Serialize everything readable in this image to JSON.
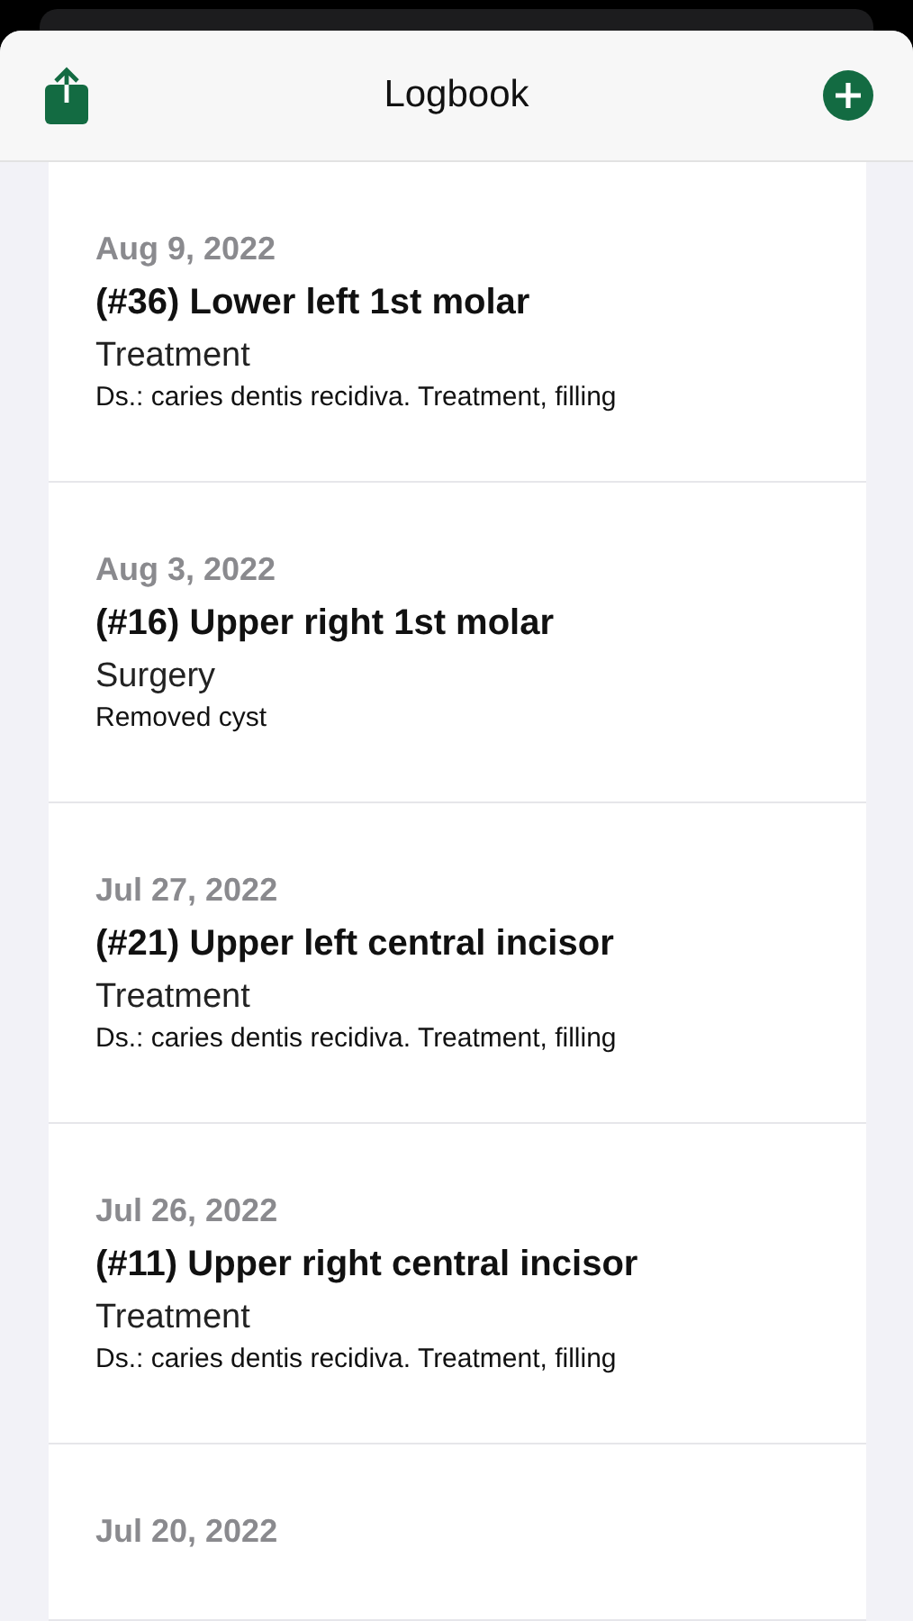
{
  "header": {
    "title": "Logbook"
  },
  "entries": [
    {
      "date": "Aug 9, 2022",
      "title": "(#36) Lower left 1st molar",
      "category": "Treatment",
      "note": "Ds.: caries dentis recidiva. Treatment, filling"
    },
    {
      "date": "Aug 3, 2022",
      "title": "(#16) Upper right 1st molar",
      "category": "Surgery",
      "note": "Removed cyst"
    },
    {
      "date": "Jul 27, 2022",
      "title": "(#21) Upper left central incisor",
      "category": "Treatment",
      "note": "Ds.: caries dentis recidiva. Treatment, filling"
    },
    {
      "date": "Jul 26, 2022",
      "title": "(#11) Upper right central incisor",
      "category": "Treatment",
      "note": "Ds.: caries dentis recidiva. Treatment, filling"
    },
    {
      "date": "Jul 20, 2022"
    }
  ]
}
